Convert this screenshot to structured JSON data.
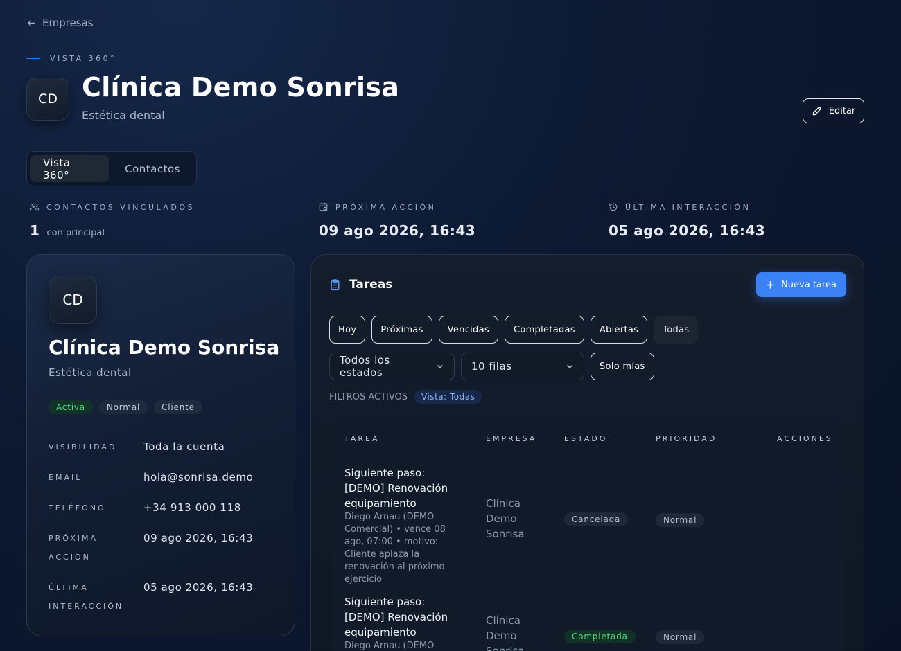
{
  "nav": {
    "back_label": "Empresas"
  },
  "header": {
    "eyebrow": "VISTA 360°",
    "initials": "CD",
    "title": "Clínica Demo Sonrisa",
    "subtitle": "Estética dental",
    "edit_label": "Editar"
  },
  "tabs": [
    {
      "label": "Vista 360°",
      "active": true
    },
    {
      "label": "Contactos",
      "active": false
    }
  ],
  "stats": {
    "contacts": {
      "label": "CONTACTOS VINCULADOS",
      "value": "1",
      "sub": "con principal"
    },
    "next_action": {
      "label": "PRÓXIMA ACCIÓN",
      "value": "09 ago 2026, 16:43"
    },
    "last_interaction": {
      "label": "ÚLTIMA INTERACCIÓN",
      "value": "05 ago 2026, 16:43"
    }
  },
  "profile": {
    "initials": "CD",
    "name": "Clínica Demo Sonrisa",
    "industry": "Estética dental",
    "badges": [
      "Activa",
      "Normal",
      "Cliente"
    ],
    "fields": [
      {
        "key": "VISIBILIDAD",
        "value": "Toda la cuenta"
      },
      {
        "key": "EMAIL",
        "value": "hola@sonrisa.demo"
      },
      {
        "key": "TELÉFONO",
        "value": "+34 913 000 118"
      },
      {
        "key": "PRÓXIMA ACCIÓN",
        "value": "09 ago 2026, 16:43"
      },
      {
        "key": "ÚLTIMA INTERACCIÓN",
        "value": "05 ago 2026, 16:43"
      }
    ]
  },
  "tasks": {
    "title": "Tareas",
    "new_label": "Nueva tarea",
    "filters": [
      "Hoy",
      "Próximas",
      "Vencidas",
      "Completadas",
      "Abiertas",
      "Todas"
    ],
    "active_filter": "Todas",
    "status_select": "Todos los estados",
    "rows_select": "10 filas",
    "mine_label": "Solo mías",
    "active_filters_label": "FILTROS ACTIVOS",
    "active_chip": "Vista: Todas",
    "columns": [
      "TAREA",
      "EMPRESA",
      "ESTADO",
      "PRIORIDAD",
      "ACCIONES"
    ],
    "rows": [
      {
        "title": "Siguiente paso: [DEMO] Renovación equipamiento",
        "meta": "Diego Arnau (DEMO Comercial) • vence 08 ago, 07:00 • motivo: Cliente aplaza la renovación al próximo ejercicio",
        "company": "Clínica Demo Sonrisa",
        "state": "Cancelada",
        "priority": "Normal"
      },
      {
        "title": "Siguiente paso: [DEMO] Renovación equipamiento",
        "meta": "Diego Arnau (DEMO",
        "company": "Clínica Demo Sonrisa",
        "state": "Completada",
        "priority": "Normal"
      }
    ]
  }
}
